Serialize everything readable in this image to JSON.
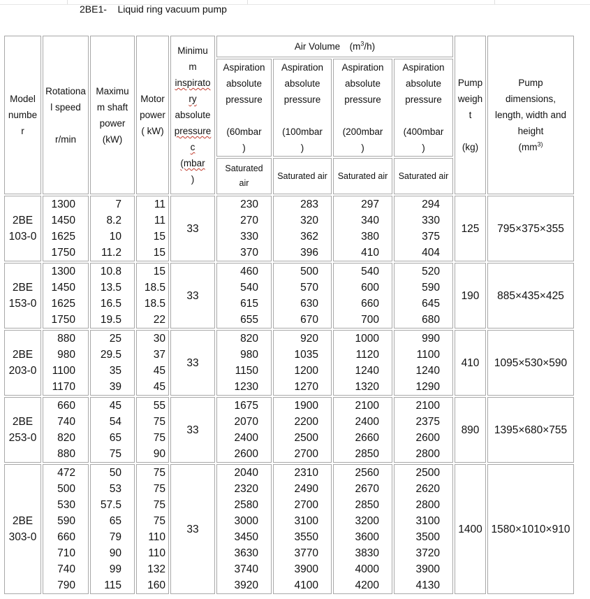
{
  "title": "2BE1-    Liquid ring vacuum pump",
  "headers": {
    "model": [
      "Model",
      "numbe",
      "r"
    ],
    "speed": [
      "Rotationa",
      "l speed",
      "",
      "r/min"
    ],
    "shaft": [
      "Maximu",
      "m shaft",
      "power",
      "(kW)"
    ],
    "motor": [
      "Motor",
      "power",
      "( kW)"
    ],
    "min_pressure": [
      "Minimu",
      "m",
      "inspirato",
      "ry",
      "absolute",
      "pressure",
      "c",
      "(mbar",
      ")"
    ],
    "air_volume": "Air Volume　(m",
    "air_volume_sup": "3",
    "air_volume_end": "/h)",
    "aspiration": [
      [
        "Aspiration",
        "absolute",
        "pressure",
        "",
        "(60mbar",
        ")"
      ],
      [
        "Aspiration",
        "absolute",
        "pressure",
        "",
        "(100mbar",
        ")"
      ],
      [
        "Aspiration",
        "absolute",
        "pressure",
        "",
        "(200mbar",
        ")"
      ],
      [
        "Aspiration",
        "absolute",
        "pressure",
        "",
        "(400mbar",
        ")"
      ]
    ],
    "saturated": [
      [
        "Saturated",
        "air"
      ],
      "Saturated air",
      "Saturated air",
      "Saturated air"
    ],
    "weight": [
      "Pump",
      "weigh",
      "t",
      "",
      "(kg)"
    ],
    "dims": [
      "Pump",
      "dimensions,",
      "length, width and",
      "height",
      "(mm"
    ],
    "dims_sup": "3)"
  },
  "rows": [
    {
      "model": [
        "2BE",
        "103-0"
      ],
      "speed": [
        "1300",
        "1450",
        "1625",
        "1750"
      ],
      "shaft": [
        "7",
        "8.2",
        "10",
        "11.2"
      ],
      "motor": [
        "11",
        "11",
        "15",
        "15"
      ],
      "min_p": "33",
      "v60": [
        "230",
        "270",
        "330",
        "370"
      ],
      "v100": [
        "283",
        "320",
        "362",
        "396"
      ],
      "v200": [
        "297",
        "340",
        "380",
        "410"
      ],
      "v400": [
        "294",
        "330",
        "375",
        "404"
      ],
      "weight": "125",
      "dims": "795×375×355"
    },
    {
      "model": [
        "2BE",
        "153-0"
      ],
      "speed": [
        "1300",
        "1450",
        "1625",
        "1750"
      ],
      "shaft": [
        "10.8",
        "13.5",
        "16.5",
        "19.5"
      ],
      "motor": [
        "15",
        "18.5",
        "18.5",
        "22"
      ],
      "min_p": "33",
      "v60": [
        "460",
        "540",
        "615",
        "655"
      ],
      "v100": [
        "500",
        "570",
        "630",
        "670"
      ],
      "v200": [
        "540",
        "600",
        "660",
        "700"
      ],
      "v400": [
        "520",
        "590",
        "645",
        "680"
      ],
      "weight": "190",
      "dims": "885×435×425"
    },
    {
      "model": [
        "2BE",
        "203-0"
      ],
      "speed": [
        "880",
        "980",
        "1100",
        "1170"
      ],
      "shaft": [
        "25",
        "29.5",
        "35",
        "39"
      ],
      "motor": [
        "30",
        "37",
        "45",
        "45"
      ],
      "min_p": "33",
      "v60": [
        "820",
        "980",
        "1150",
        "1230"
      ],
      "v100": [
        "920",
        "1035",
        "1200",
        "1270"
      ],
      "v200": [
        "1000",
        "1120",
        "1240",
        "1320"
      ],
      "v400": [
        "990",
        "1100",
        "1240",
        "1290"
      ],
      "weight": "410",
      "dims": "1095×530×590"
    },
    {
      "model": [
        "2BE",
        "253-0"
      ],
      "speed": [
        "660",
        "740",
        "820",
        "880"
      ],
      "shaft": [
        "45",
        "54",
        "65",
        "75"
      ],
      "motor": [
        "55",
        "75",
        "75",
        "90"
      ],
      "min_p": "33",
      "v60": [
        "1675",
        "2070",
        "2400",
        "2600"
      ],
      "v100": [
        "1900",
        "2200",
        "2500",
        "2700"
      ],
      "v200": [
        "2100",
        "2400",
        "2660",
        "2850"
      ],
      "v400": [
        "2100",
        "2375",
        "2600",
        "2800"
      ],
      "weight": "890",
      "dims": "1395×680×755"
    },
    {
      "model": [
        "2BE",
        "303-0"
      ],
      "speed": [
        "472",
        "500",
        "530",
        "590",
        "660",
        "710",
        "740",
        "790"
      ],
      "shaft": [
        "50",
        "53",
        "57.5",
        "65",
        "79",
        "90",
        "99",
        "115"
      ],
      "motor": [
        "75",
        "75",
        "75",
        "75",
        "110",
        "110",
        "132",
        "160"
      ],
      "min_p": "33",
      "v60": [
        "2040",
        "2320",
        "2580",
        "3000",
        "3450",
        "3630",
        "3740",
        "3920"
      ],
      "v100": [
        "2310",
        "2490",
        "2700",
        "3100",
        "3550",
        "3770",
        "3900",
        "4100"
      ],
      "v200": [
        "2560",
        "2670",
        "2850",
        "3200",
        "3600",
        "3830",
        "4000",
        "4200"
      ],
      "v400": [
        "2500",
        "2620",
        "2800",
        "3100",
        "3500",
        "3720",
        "3900",
        "4130"
      ],
      "weight": "1400",
      "dims": "1580×1010×910"
    }
  ]
}
